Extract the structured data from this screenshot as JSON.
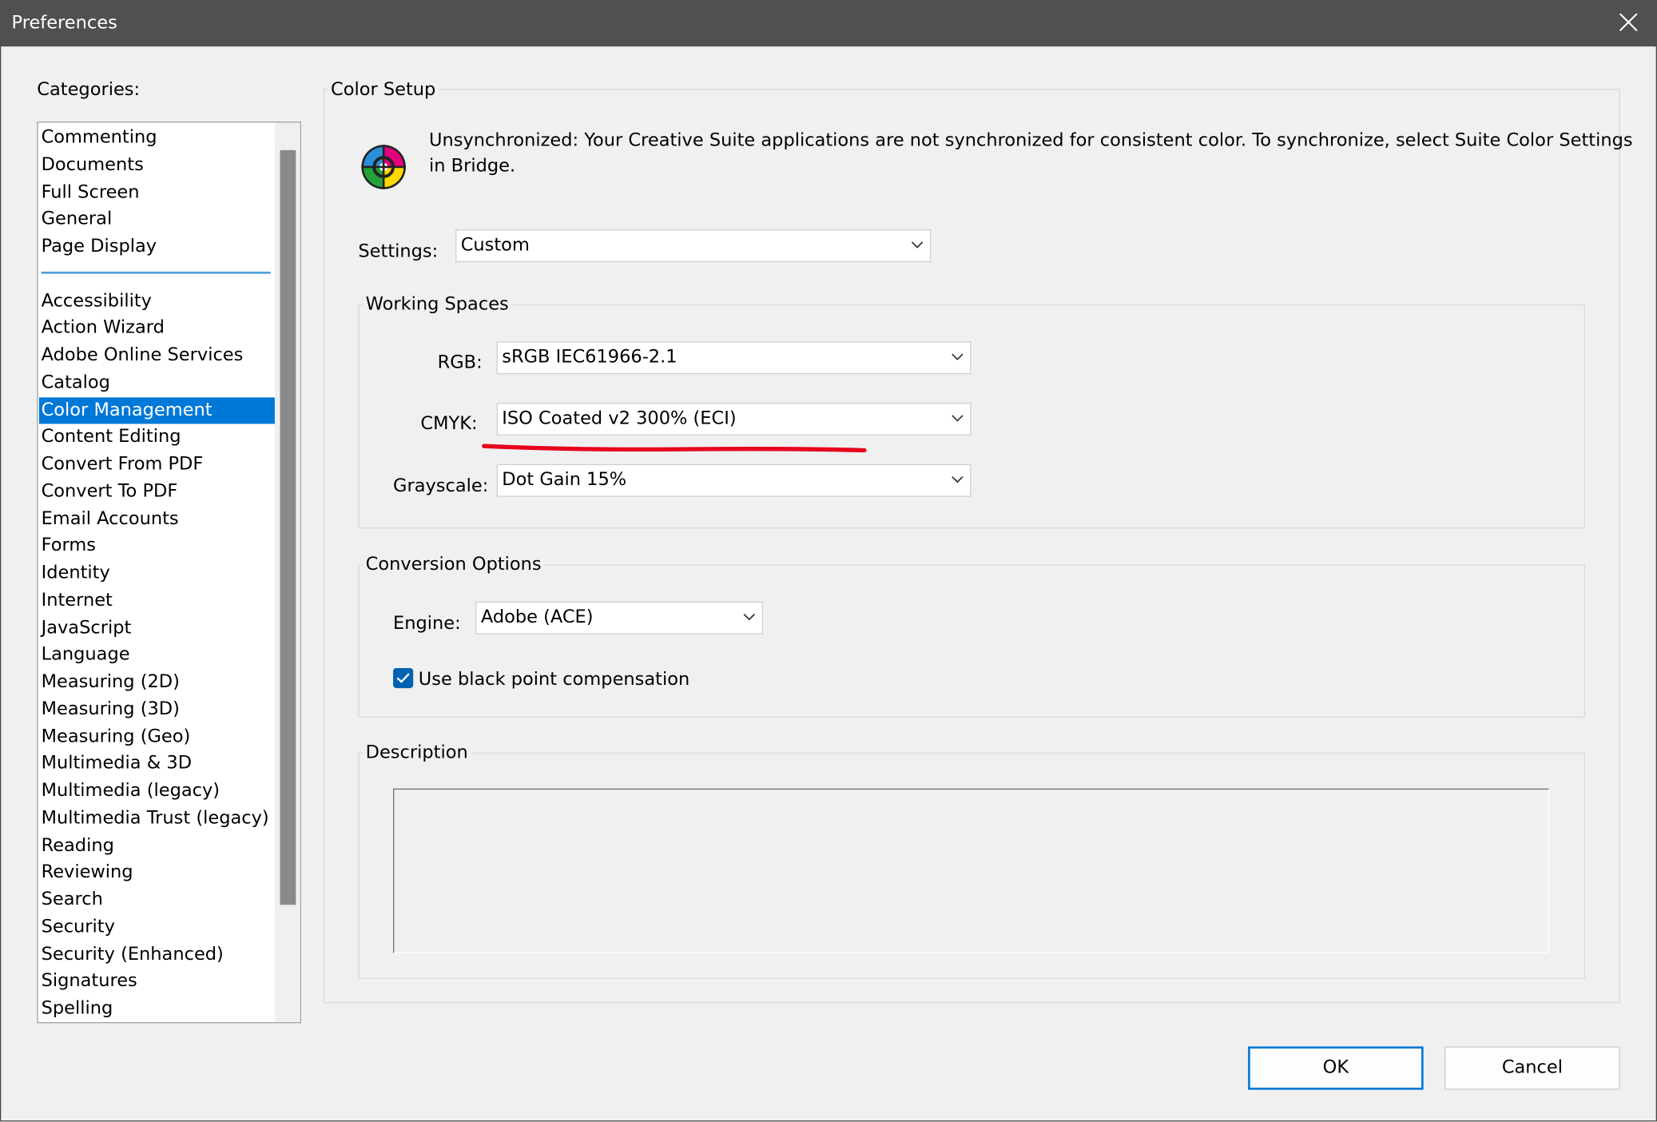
{
  "window": {
    "title": "Preferences"
  },
  "categories": {
    "label": "Categories:",
    "group1": [
      "Commenting",
      "Documents",
      "Full Screen",
      "General",
      "Page Display"
    ],
    "group2": [
      "Accessibility",
      "Action Wizard",
      "Adobe Online Services",
      "Catalog",
      "Color Management",
      "Content Editing",
      "Convert From PDF",
      "Convert To PDF",
      "Email Accounts",
      "Forms",
      "Identity",
      "Internet",
      "JavaScript",
      "Language",
      "Measuring (2D)",
      "Measuring (3D)",
      "Measuring (Geo)",
      "Multimedia & 3D",
      "Multimedia (legacy)",
      "Multimedia Trust (legacy)",
      "Reading",
      "Reviewing",
      "Search",
      "Security",
      "Security (Enhanced)",
      "Signatures",
      "Spelling"
    ],
    "selected": "Color Management"
  },
  "color_setup": {
    "heading": "Color Setup",
    "message_line1": "Unsynchronized: Your Creative Suite applications are not synchronized for consistent color. To synchronize, select Suite Color Settings",
    "message_line2": "in Bridge.",
    "settings_label": "Settings:",
    "settings_value": "Custom"
  },
  "working_spaces": {
    "heading": "Working Spaces",
    "rgb_label": "RGB:",
    "rgb_value": "sRGB IEC61966-2.1",
    "cmyk_label": "CMYK:",
    "cmyk_value": "ISO Coated v2 300% (ECI)",
    "grayscale_label": "Grayscale:",
    "grayscale_value": "Dot Gain 15%"
  },
  "conversion_options": {
    "heading": "Conversion Options",
    "engine_label": "Engine:",
    "engine_value": "Adobe (ACE)",
    "black_point_label": "Use black point compensation",
    "black_point_checked": true
  },
  "description": {
    "heading": "Description",
    "text": ""
  },
  "buttons": {
    "ok": "OK",
    "cancel": "Cancel"
  },
  "colors": {
    "titlebar": "#505050",
    "selection": "#0078d7",
    "annotation": "#e8001c",
    "checkbox": "#0063b1"
  },
  "icons": {
    "close": "close-icon",
    "color_wheel": "color-management-icon",
    "dropdown": "chevron-down-icon",
    "check": "checkmark-icon"
  }
}
